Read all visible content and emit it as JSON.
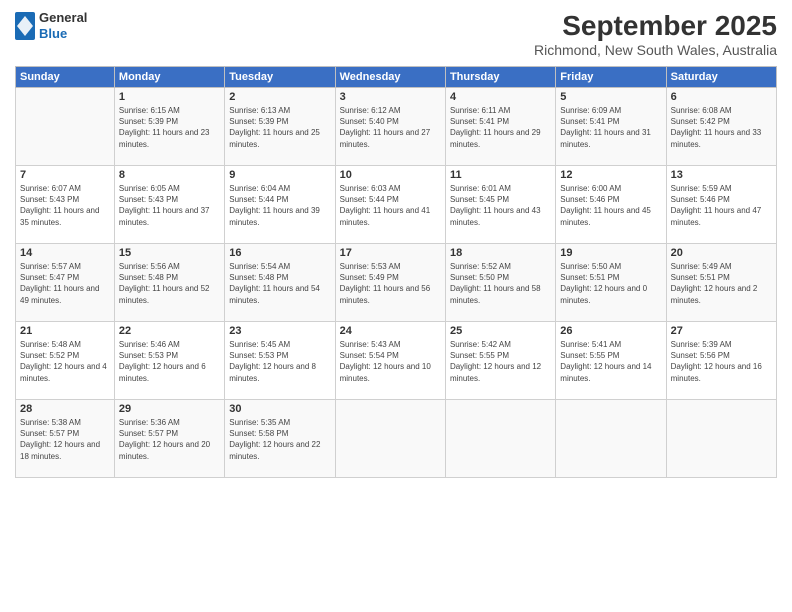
{
  "header": {
    "logo": {
      "line1": "General",
      "line2": "Blue"
    },
    "title": "September 2025",
    "location": "Richmond, New South Wales, Australia"
  },
  "days_of_week": [
    "Sunday",
    "Monday",
    "Tuesday",
    "Wednesday",
    "Thursday",
    "Friday",
    "Saturday"
  ],
  "weeks": [
    [
      {
        "day": "",
        "sunrise": "",
        "sunset": "",
        "daylight": ""
      },
      {
        "day": "1",
        "sunrise": "6:15 AM",
        "sunset": "5:39 PM",
        "daylight": "11 hours and 23 minutes."
      },
      {
        "day": "2",
        "sunrise": "6:13 AM",
        "sunset": "5:39 PM",
        "daylight": "11 hours and 25 minutes."
      },
      {
        "day": "3",
        "sunrise": "6:12 AM",
        "sunset": "5:40 PM",
        "daylight": "11 hours and 27 minutes."
      },
      {
        "day": "4",
        "sunrise": "6:11 AM",
        "sunset": "5:41 PM",
        "daylight": "11 hours and 29 minutes."
      },
      {
        "day": "5",
        "sunrise": "6:09 AM",
        "sunset": "5:41 PM",
        "daylight": "11 hours and 31 minutes."
      },
      {
        "day": "6",
        "sunrise": "6:08 AM",
        "sunset": "5:42 PM",
        "daylight": "11 hours and 33 minutes."
      }
    ],
    [
      {
        "day": "7",
        "sunrise": "6:07 AM",
        "sunset": "5:43 PM",
        "daylight": "11 hours and 35 minutes."
      },
      {
        "day": "8",
        "sunrise": "6:05 AM",
        "sunset": "5:43 PM",
        "daylight": "11 hours and 37 minutes."
      },
      {
        "day": "9",
        "sunrise": "6:04 AM",
        "sunset": "5:44 PM",
        "daylight": "11 hours and 39 minutes."
      },
      {
        "day": "10",
        "sunrise": "6:03 AM",
        "sunset": "5:44 PM",
        "daylight": "11 hours and 41 minutes."
      },
      {
        "day": "11",
        "sunrise": "6:01 AM",
        "sunset": "5:45 PM",
        "daylight": "11 hours and 43 minutes."
      },
      {
        "day": "12",
        "sunrise": "6:00 AM",
        "sunset": "5:46 PM",
        "daylight": "11 hours and 45 minutes."
      },
      {
        "day": "13",
        "sunrise": "5:59 AM",
        "sunset": "5:46 PM",
        "daylight": "11 hours and 47 minutes."
      }
    ],
    [
      {
        "day": "14",
        "sunrise": "5:57 AM",
        "sunset": "5:47 PM",
        "daylight": "11 hours and 49 minutes."
      },
      {
        "day": "15",
        "sunrise": "5:56 AM",
        "sunset": "5:48 PM",
        "daylight": "11 hours and 52 minutes."
      },
      {
        "day": "16",
        "sunrise": "5:54 AM",
        "sunset": "5:48 PM",
        "daylight": "11 hours and 54 minutes."
      },
      {
        "day": "17",
        "sunrise": "5:53 AM",
        "sunset": "5:49 PM",
        "daylight": "11 hours and 56 minutes."
      },
      {
        "day": "18",
        "sunrise": "5:52 AM",
        "sunset": "5:50 PM",
        "daylight": "11 hours and 58 minutes."
      },
      {
        "day": "19",
        "sunrise": "5:50 AM",
        "sunset": "5:51 PM",
        "daylight": "12 hours and 0 minutes."
      },
      {
        "day": "20",
        "sunrise": "5:49 AM",
        "sunset": "5:51 PM",
        "daylight": "12 hours and 2 minutes."
      }
    ],
    [
      {
        "day": "21",
        "sunrise": "5:48 AM",
        "sunset": "5:52 PM",
        "daylight": "12 hours and 4 minutes."
      },
      {
        "day": "22",
        "sunrise": "5:46 AM",
        "sunset": "5:53 PM",
        "daylight": "12 hours and 6 minutes."
      },
      {
        "day": "23",
        "sunrise": "5:45 AM",
        "sunset": "5:53 PM",
        "daylight": "12 hours and 8 minutes."
      },
      {
        "day": "24",
        "sunrise": "5:43 AM",
        "sunset": "5:54 PM",
        "daylight": "12 hours and 10 minutes."
      },
      {
        "day": "25",
        "sunrise": "5:42 AM",
        "sunset": "5:55 PM",
        "daylight": "12 hours and 12 minutes."
      },
      {
        "day": "26",
        "sunrise": "5:41 AM",
        "sunset": "5:55 PM",
        "daylight": "12 hours and 14 minutes."
      },
      {
        "day": "27",
        "sunrise": "5:39 AM",
        "sunset": "5:56 PM",
        "daylight": "12 hours and 16 minutes."
      }
    ],
    [
      {
        "day": "28",
        "sunrise": "5:38 AM",
        "sunset": "5:57 PM",
        "daylight": "12 hours and 18 minutes."
      },
      {
        "day": "29",
        "sunrise": "5:36 AM",
        "sunset": "5:57 PM",
        "daylight": "12 hours and 20 minutes."
      },
      {
        "day": "30",
        "sunrise": "5:35 AM",
        "sunset": "5:58 PM",
        "daylight": "12 hours and 22 minutes."
      },
      {
        "day": "",
        "sunrise": "",
        "sunset": "",
        "daylight": ""
      },
      {
        "day": "",
        "sunrise": "",
        "sunset": "",
        "daylight": ""
      },
      {
        "day": "",
        "sunrise": "",
        "sunset": "",
        "daylight": ""
      },
      {
        "day": "",
        "sunrise": "",
        "sunset": "",
        "daylight": ""
      }
    ]
  ]
}
